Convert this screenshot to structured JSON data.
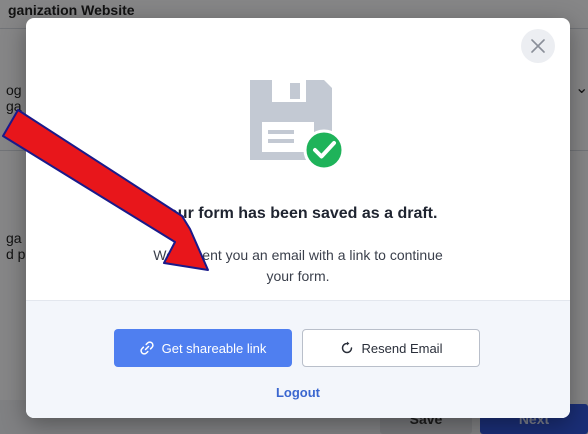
{
  "background": {
    "header_text": "ganization Website",
    "fragment_1": "og",
    "fragment_2": "ga",
    "fragment_3": "ga",
    "fragment_4": "d p",
    "save_label": "Save",
    "next_label": "Next"
  },
  "modal": {
    "title": "Your form has been saved as a draft.",
    "message": "We've sent you an email with a link to continue your form.",
    "share_button_label": "Get shareable link",
    "resend_button_label": "Resend Email",
    "logout_label": "Logout",
    "icons": {
      "close": "close-icon",
      "illustration": "floppy-disk-icon",
      "check": "check-circle-icon",
      "share": "link-icon",
      "resend": "refresh-icon"
    }
  },
  "colors": {
    "primary": "#4f7ff0",
    "success": "#1fb35a",
    "link": "#3a66cf",
    "annotation": "#e8161b"
  }
}
